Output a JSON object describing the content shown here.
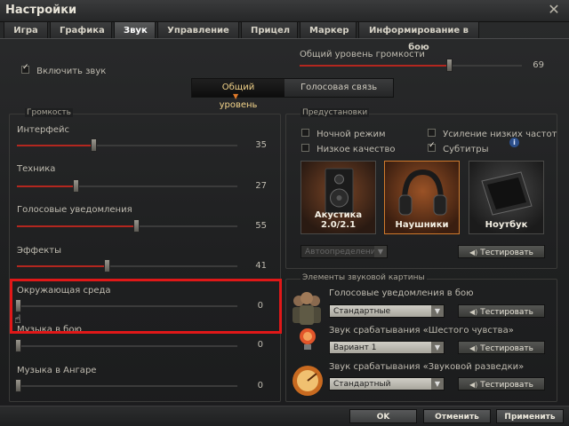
{
  "window": {
    "title": "Настройки",
    "close_glyph": "✕"
  },
  "tabs": [
    "Игра",
    "Графика",
    "Звук",
    "Управление",
    "Прицел",
    "Маркер",
    "Информирование в бою"
  ],
  "active_tab": "Звук",
  "enable_sound": {
    "label": "Включить звук",
    "checked": true
  },
  "master_volume": {
    "label": "Общий уровень громкости",
    "value": "69",
    "fraction": 0.69
  },
  "segmented": {
    "options": [
      "Общий уровень",
      "Голосовая связь"
    ],
    "selected": "Общий уровень"
  },
  "volume": {
    "title": "Громкость",
    "sliders": [
      {
        "label": "Интерфейс",
        "value": "35",
        "fraction": 0.35
      },
      {
        "label": "Техника",
        "value": "27",
        "fraction": 0.27
      },
      {
        "label": "Голосовые уведомления",
        "value": "55",
        "fraction": 0.55
      },
      {
        "label": "Эффекты",
        "value": "41",
        "fraction": 0.41
      },
      {
        "label": "Окружающая среда",
        "value": "0",
        "fraction": 0
      },
      {
        "label": "Музыка в бою",
        "value": "0",
        "fraction": 0
      },
      {
        "label": "Музыка в Ангаре",
        "value": "0",
        "fraction": 0
      }
    ]
  },
  "presets": {
    "title": "Предустановки",
    "options": [
      {
        "label": "Ночной режим",
        "checked": false
      },
      {
        "label": "Усиление низких частот",
        "checked": false
      },
      {
        "label": "Низкое качество",
        "checked": false
      },
      {
        "label": "Субтитры",
        "checked": true
      }
    ],
    "info_glyph": "i",
    "cards": [
      {
        "label": "Акустика 2.0/2.1",
        "selected": false
      },
      {
        "label": "Наушники",
        "selected": true
      },
      {
        "label": "Ноутбук",
        "selected": false
      }
    ],
    "autodetect": "Автоопределение",
    "test_label": "Тестировать"
  },
  "elements": {
    "title": "Элементы звуковой картины",
    "items": [
      {
        "label": "Голосовые уведомления в бою",
        "value": "Стандартные"
      },
      {
        "label": "Звук срабатывания «Шестого чувства»",
        "value": "Вариант 1"
      },
      {
        "label": "Звук срабатывания «Звуковой разведки»",
        "value": "Стандартный"
      }
    ],
    "test_label": "Тестировать"
  },
  "footer": {
    "ok": "OK",
    "cancel": "Отменить",
    "apply": "Применить"
  },
  "colors": {
    "accent": "#d07a2c",
    "slider_fill": "#b3271f",
    "highlight": "#e01818"
  }
}
